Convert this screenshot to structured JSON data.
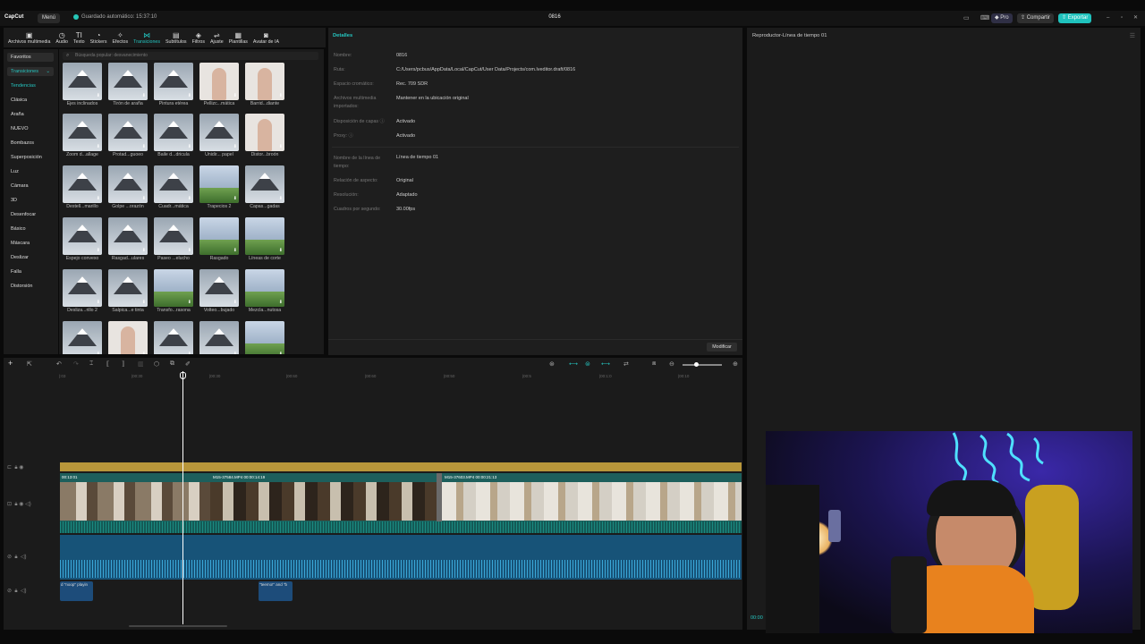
{
  "app": {
    "logo": "CapCut",
    "menu": "Menú",
    "autosave": "Guardado automático: 15:37:10",
    "project": "0816",
    "pro": "Pro",
    "share": "Compartir",
    "export": "Exportar"
  },
  "toolbar": {
    "items": [
      "Archivos multimedia",
      "Audio",
      "Texto",
      "Stickers",
      "Efectos",
      "Transiciones",
      "Subtítulos",
      "Filtros",
      "Ajuste",
      "Plantillas",
      "Avatar de IA"
    ],
    "active": "Transiciones"
  },
  "sidebar": {
    "items": [
      "Favoritos",
      "Transiciones",
      "Tendencias",
      "Clásica",
      "Araña",
      "NUEVO",
      "Bombazos",
      "Superposición",
      "Luz",
      "Cámara",
      "3D",
      "Desenfocar",
      "Básico",
      "Máscara",
      "Deslizar",
      "Falla",
      "Distorsión"
    ]
  },
  "search": {
    "placeholder": "Búsqueda popular: desvanecimiento"
  },
  "transitions": [
    "Ejes inclinados",
    "Tirón de araña",
    "Pintura etérea",
    "Pellizc...mática",
    "Barrid...diante",
    "Zoom d...allage",
    "Protad...guoeo",
    "Baile d...dricula",
    "Unidir... papel",
    "Distor...broón",
    "Destell...marillo",
    "Golpe ...orazón",
    "Cuadr...mática",
    "Trapecios 2",
    "Capas...gadas",
    "Espejo convexo",
    "Rasgad...ulares",
    "Paseo ...elucho",
    "Rasgado",
    "Líneas de corte",
    "Desliza...rillo 2",
    "Salpica...e tinta",
    "Transfo...rasona",
    "Volteo...bujado",
    "Mezcla...nutosa",
    "",
    "",
    "",
    "",
    ""
  ],
  "details": {
    "tab": "Detalles",
    "rows": [
      {
        "label": "Nombre:",
        "value": "0816"
      },
      {
        "label": "Ruta:",
        "value": "C:/Users/pcbus/AppData/Local/CapCut/User Data/Projects/com.lveditor.draft/0816"
      },
      {
        "label": "Espacio cromático:",
        "value": "Rec. 709 SDR"
      },
      {
        "label": "Archivos multimedia importados:",
        "value": "Mantener en la ubicación original"
      },
      {
        "label": "Disposición de capas ⓘ",
        "value": "Activado"
      },
      {
        "label": "Proxy: ⓘ",
        "value": "Activado"
      },
      {
        "label": "Nombre de la línea de tiempo:",
        "value": "Línea de tiempo 01"
      },
      {
        "label": "Relación de aspecto:",
        "value": "Original"
      },
      {
        "label": "Resolución:",
        "value": "Adaptado"
      },
      {
        "label": "Cuadros por segundo:",
        "value": "30.00fps"
      }
    ],
    "modify": "Modificar"
  },
  "player": {
    "title": "Reproductor-Línea de tiempo 01",
    "time": "00:00"
  },
  "timeline": {
    "ruler": [
      "|:03",
      "|00:30",
      "|00:30",
      "|00:60",
      "|00:60",
      "|00:50",
      "|00:5",
      "|00:1:0",
      "|00:10"
    ],
    "clips": [
      {
        "label": "00:13:01"
      },
      {
        "label": "M15-37584.MP4  00:00:14:19"
      },
      {
        "label": "M15-37603.MP4  00:00:21:13"
      }
    ],
    "text_clips": [
      "d \"noop\" playin",
      "\"teemo!\" and \"b"
    ]
  }
}
